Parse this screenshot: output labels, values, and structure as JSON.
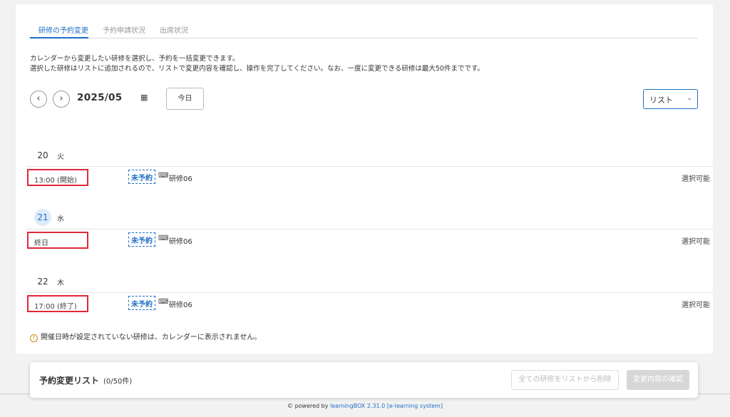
{
  "tabs": [
    {
      "label": "研修の予約変更"
    },
    {
      "label": "予約申請状況"
    },
    {
      "label": "出席状況"
    }
  ],
  "description": {
    "line1": "カレンダーから変更したい研修を選択し、予約を一括変更できます。",
    "line2": "選択した研修はリストに追加されるので、リストで変更内容を確認し、操作を完了してください。なお、一度に変更できる研修は最大50件までです。"
  },
  "nav": {
    "prev_icon": "chevron-left-icon",
    "next_icon": "chevron-right-icon",
    "month": "2025/05",
    "today_label": "今日",
    "view_value": "リスト"
  },
  "days": [
    {
      "num": "20",
      "weekday": "火",
      "today": false,
      "event": {
        "time": "13:00 (開始)",
        "badge": "未予約",
        "name": "研修06",
        "status": "選択可能"
      }
    },
    {
      "num": "21",
      "weekday": "水",
      "today": true,
      "event": {
        "time": "終日",
        "badge": "未予約",
        "name": "研修06",
        "status": "選択可能"
      }
    },
    {
      "num": "22",
      "weekday": "木",
      "today": false,
      "event": {
        "time": "17:00 (終了)",
        "badge": "未予約",
        "name": "研修06",
        "status": "選択可能"
      }
    }
  ],
  "note": "開催日時が設定されていない研修は、カレンダーに表示されません。",
  "bottom_bar": {
    "title": "予約変更リスト",
    "count": "(0/50件)",
    "clear_label": "全ての研修をリストから削除",
    "confirm_label": "変更内容の確認"
  },
  "footer": {
    "prefix": "© powered by ",
    "link": "learningBOX 2.31.0 [e-learning system]"
  }
}
